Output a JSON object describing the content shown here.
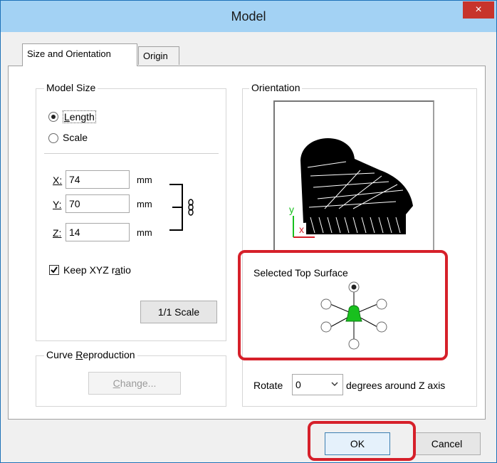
{
  "window": {
    "title": "Model",
    "close_glyph": "×"
  },
  "tabs": [
    {
      "label": "Size and Orientation"
    },
    {
      "label": "Origin"
    }
  ],
  "model_size": {
    "legend": "Model Size",
    "length_label": "Length",
    "scale_label": "Scale",
    "selected": "Length",
    "x_label": "X:",
    "x_value": "74",
    "y_label": "Y:",
    "y_value": "70",
    "z_label": "Z:",
    "z_value": "14",
    "unit": "mm",
    "keep_ratio_label": "Keep XYZ ratio",
    "keep_ratio_checked": true,
    "scale_button": "1/1 Scale"
  },
  "curve": {
    "legend": "Curve Reproduction",
    "change_button": "Change..."
  },
  "orientation": {
    "legend": "Orientation",
    "axis_y": "y",
    "axis_x": "x",
    "top_surface_label": "Selected Top Surface",
    "rotate_label": "Rotate",
    "rotate_value": "0",
    "rotate_suffix": "degrees around Z axis"
  },
  "footer": {
    "ok": "OK",
    "cancel": "Cancel"
  },
  "colors": {
    "highlight": "#d6202a",
    "title_bar": "#a3d2f4",
    "figure_green": "#18c01e"
  },
  "icons": {
    "link": "chain-link-icon",
    "check": "checkmark-icon",
    "dropdown": "chevron-down-icon"
  }
}
